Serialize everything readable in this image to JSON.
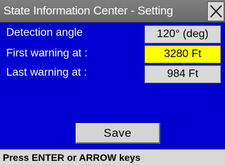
{
  "window": {
    "title": "State Information Center - Setting",
    "close_icon": "close-icon"
  },
  "settings": [
    {
      "label": "Detection angle",
      "value": "120° (deg)",
      "highlighted": false
    },
    {
      "label": "First warning at :",
      "value": "3280 Ft",
      "highlighted": true
    },
    {
      "label": "Last warning at :",
      "value": "984 Ft",
      "highlighted": false
    }
  ],
  "save_button": {
    "label": "Save"
  },
  "status_bar": {
    "text": "Press ENTER or ARROW keys"
  },
  "colors": {
    "title_bar": "#6f6f6f",
    "panel": "#0000d0",
    "highlight": "#ffff00",
    "value_box": "#d9d9d9"
  }
}
